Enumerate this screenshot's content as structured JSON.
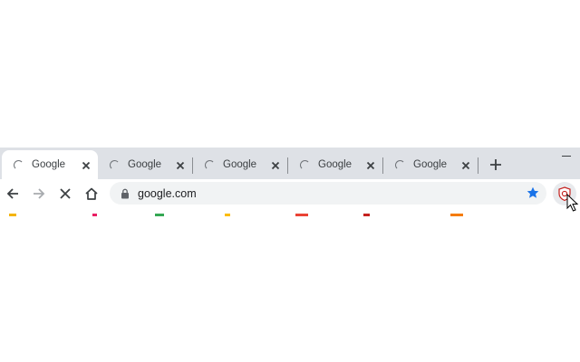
{
  "tabs": [
    {
      "title": "Google",
      "active": true
    },
    {
      "title": "Google",
      "active": false
    },
    {
      "title": "Google",
      "active": false
    },
    {
      "title": "Google",
      "active": false
    },
    {
      "title": "Google",
      "active": false
    }
  ],
  "toolbar": {
    "url": "google.com",
    "back_icon": "arrow-left-icon",
    "forward_icon": "arrow-right-icon",
    "stop_icon": "close-icon",
    "home_icon": "home-icon",
    "bookmark_icon": "star-icon",
    "extension_icon": "shield-extension-icon"
  },
  "colors": {
    "tabstrip_bg": "#dee1e6",
    "active_tab_bg": "#ffffff",
    "omnibox_bg": "#f1f3f4",
    "star": "#1a73e8",
    "extension_accent": "#c5221f"
  },
  "bookmark_favicon_colors": [
    "#f4b400",
    "#e91e63",
    "#34a853",
    "#fbbc04",
    "#ea4335",
    "#c5221f",
    "#f57c00"
  ]
}
